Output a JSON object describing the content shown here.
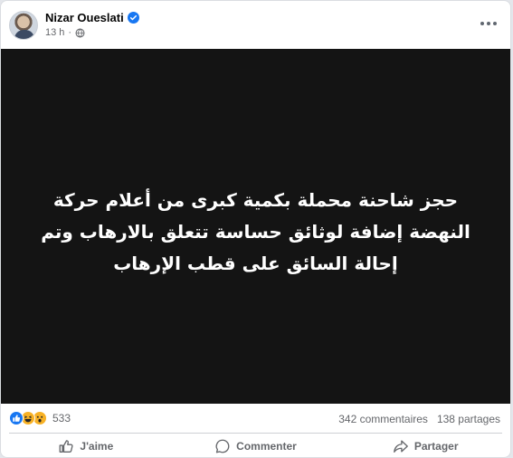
{
  "post": {
    "author": "Nizar Oueslati",
    "time": "13 h",
    "separator": "·",
    "text": "حجز شاحنة محملة بكمية كبرى من أعلام حركة النهضة إضافة لوثائق حساسة تتعلق بالارهاب وتم إحالة السائق على قطب الإرهاب",
    "media_background": "#141414"
  },
  "reactions": {
    "types": [
      "like",
      "haha",
      "wow"
    ],
    "count": "533"
  },
  "counts": {
    "comments": "342 commentaires",
    "shares": "138 partages"
  },
  "actions": {
    "like_label": "J'aime",
    "comment_label": "Commenter",
    "share_label": "Partager"
  },
  "colors": {
    "verified": "#1877f2",
    "muted_text": "#65676b",
    "like_blue": "#1877f2",
    "reaction_yellow": "#f7b125"
  }
}
